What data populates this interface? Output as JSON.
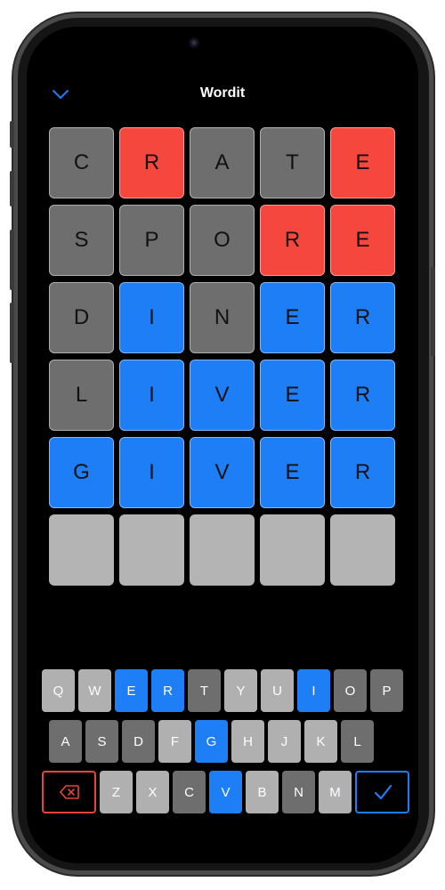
{
  "header": {
    "title": "Wordit"
  },
  "colors": {
    "absent": "#6e6e6e",
    "misplaced": "#f5473e",
    "correct": "#1e7ef5",
    "empty": "#b4b4b4",
    "key_unused": "#b0b0b0",
    "key_absent": "#6e6e6e",
    "key_correct": "#1e7ef5",
    "delete": "#e8443a",
    "submit": "#1e7ef5"
  },
  "board": [
    [
      {
        "letter": "C",
        "state": "absent"
      },
      {
        "letter": "R",
        "state": "misplaced"
      },
      {
        "letter": "A",
        "state": "absent"
      },
      {
        "letter": "T",
        "state": "absent"
      },
      {
        "letter": "E",
        "state": "misplaced"
      }
    ],
    [
      {
        "letter": "S",
        "state": "absent"
      },
      {
        "letter": "P",
        "state": "absent"
      },
      {
        "letter": "O",
        "state": "absent"
      },
      {
        "letter": "R",
        "state": "misplaced"
      },
      {
        "letter": "E",
        "state": "misplaced"
      }
    ],
    [
      {
        "letter": "D",
        "state": "absent"
      },
      {
        "letter": "I",
        "state": "correct"
      },
      {
        "letter": "N",
        "state": "absent"
      },
      {
        "letter": "E",
        "state": "correct"
      },
      {
        "letter": "R",
        "state": "correct"
      }
    ],
    [
      {
        "letter": "L",
        "state": "absent"
      },
      {
        "letter": "I",
        "state": "correct"
      },
      {
        "letter": "V",
        "state": "correct"
      },
      {
        "letter": "E",
        "state": "correct"
      },
      {
        "letter": "R",
        "state": "correct"
      }
    ],
    [
      {
        "letter": "G",
        "state": "correct"
      },
      {
        "letter": "I",
        "state": "correct"
      },
      {
        "letter": "V",
        "state": "correct"
      },
      {
        "letter": "E",
        "state": "correct"
      },
      {
        "letter": "R",
        "state": "correct"
      }
    ],
    [
      {
        "letter": "",
        "state": "empty"
      },
      {
        "letter": "",
        "state": "empty"
      },
      {
        "letter": "",
        "state": "empty"
      },
      {
        "letter": "",
        "state": "empty"
      },
      {
        "letter": "",
        "state": "empty"
      }
    ]
  ],
  "keyboard": {
    "rows": [
      [
        {
          "k": "Q",
          "s": "unused"
        },
        {
          "k": "W",
          "s": "unused"
        },
        {
          "k": "E",
          "s": "correct"
        },
        {
          "k": "R",
          "s": "correct"
        },
        {
          "k": "T",
          "s": "absent"
        },
        {
          "k": "Y",
          "s": "unused"
        },
        {
          "k": "U",
          "s": "unused"
        },
        {
          "k": "I",
          "s": "correct"
        },
        {
          "k": "O",
          "s": "absent"
        },
        {
          "k": "P",
          "s": "absent"
        }
      ],
      [
        {
          "k": "A",
          "s": "absent"
        },
        {
          "k": "S",
          "s": "absent"
        },
        {
          "k": "D",
          "s": "absent"
        },
        {
          "k": "F",
          "s": "unused"
        },
        {
          "k": "G",
          "s": "correct"
        },
        {
          "k": "H",
          "s": "unused"
        },
        {
          "k": "J",
          "s": "unused"
        },
        {
          "k": "K",
          "s": "unused"
        },
        {
          "k": "L",
          "s": "absent"
        }
      ],
      [
        {
          "k": "Z",
          "s": "unused"
        },
        {
          "k": "X",
          "s": "unused"
        },
        {
          "k": "C",
          "s": "absent"
        },
        {
          "k": "V",
          "s": "correct"
        },
        {
          "k": "B",
          "s": "unused"
        },
        {
          "k": "N",
          "s": "absent"
        },
        {
          "k": "M",
          "s": "unused"
        }
      ]
    ],
    "delete_icon": "backspace-icon",
    "submit_icon": "checkmark-icon"
  }
}
